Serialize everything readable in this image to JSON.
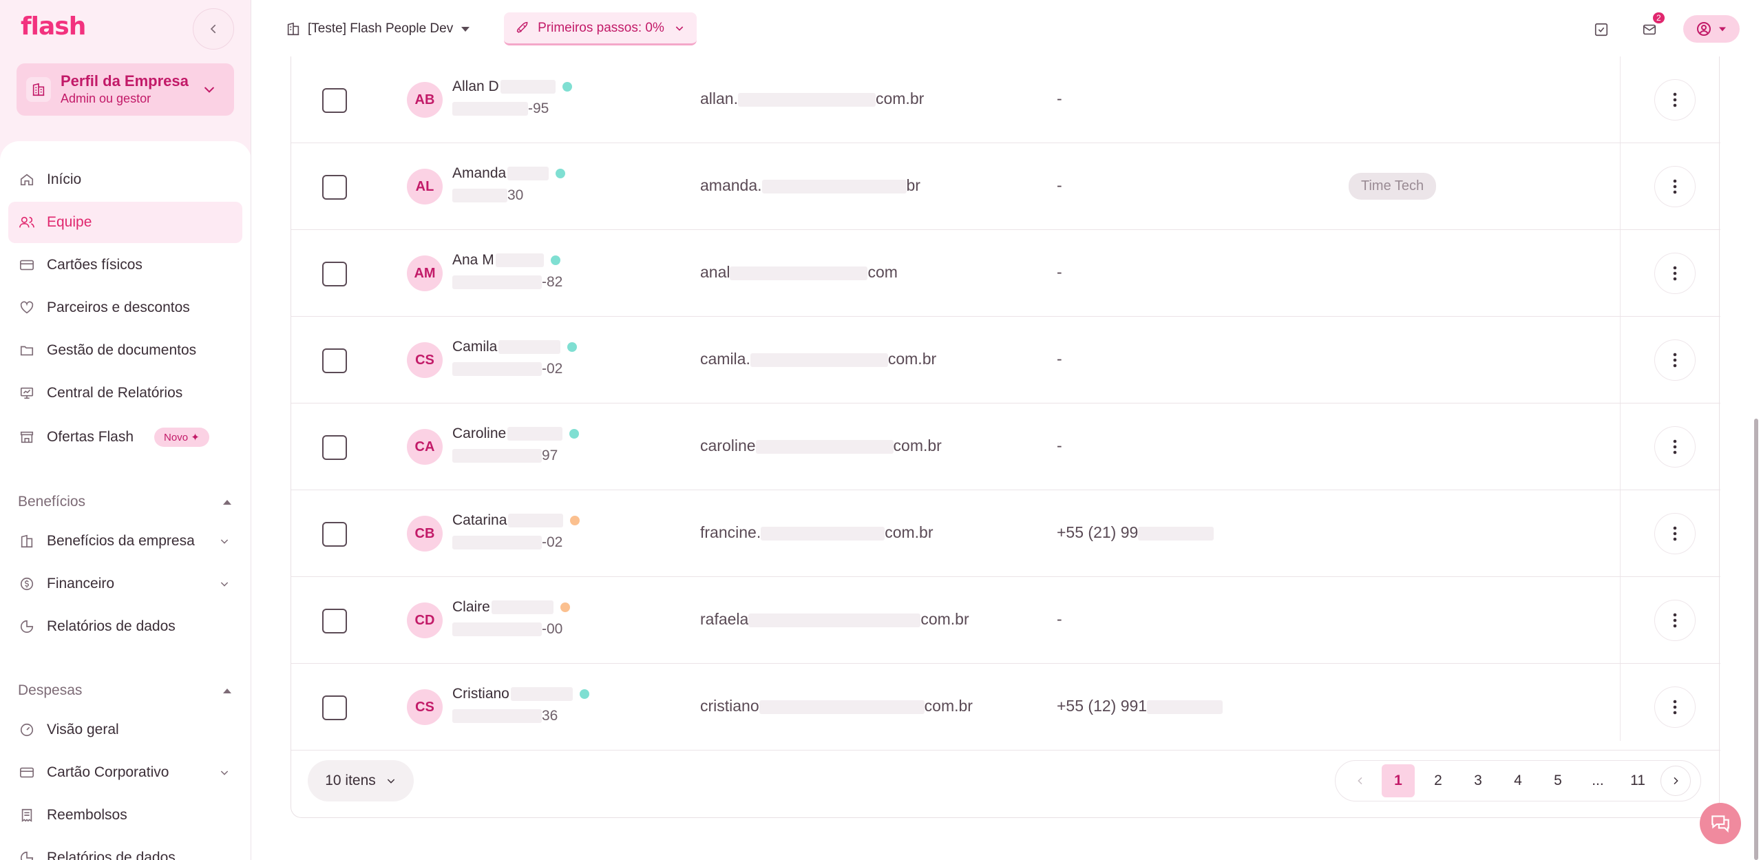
{
  "brand": {
    "logo": "flash"
  },
  "company": {
    "title": "Perfil da Empresa",
    "role": "Admin ou gestor"
  },
  "nav": {
    "inicio": "Início",
    "equipe": "Equipe",
    "cartoes": "Cartões físicos",
    "parceiros": "Parceiros e descontos",
    "documentos": "Gestão de documentos",
    "relatorios": "Central de Relatórios",
    "ofertas": "Ofertas Flash",
    "ofertas_badge": "Novo ✦"
  },
  "beneficios": {
    "header": "Benefícios",
    "empresa": "Benefícios da empresa",
    "financeiro": "Financeiro",
    "relatorios": "Relatórios de dados"
  },
  "despesas": {
    "header": "Despesas",
    "visao": "Visão geral",
    "cartao": "Cartão Corporativo",
    "reembolsos": "Reembolsos",
    "relatorios": "Relatórios de dados"
  },
  "topbar": {
    "workspace": "[Teste] Flash People Dev",
    "onboarding": "Primeiros passos: 0%",
    "notifications_count": "2"
  },
  "rows": [
    {
      "initials": "AB",
      "name": "Allan D",
      "cpf_end": "-95",
      "email_start": "allan.",
      "email_end": "com.br",
      "phone": "-",
      "dept": "",
      "status_color": "#7fdfd2"
    },
    {
      "initials": "AL",
      "name": "Amanda",
      "cpf_end": "30",
      "email_start": "amanda.",
      "email_end": "br",
      "phone": "-",
      "dept": "Time Tech",
      "status_color": "#7fdfd2"
    },
    {
      "initials": "AM",
      "name": "Ana M",
      "cpf_end": "-82",
      "email_start": "anal",
      "email_end": "com",
      "phone": "-",
      "dept": "",
      "status_color": "#7fdfd2"
    },
    {
      "initials": "CS",
      "name": "Camila",
      "cpf_end": "-02",
      "email_start": "camila.",
      "email_end": "com.br",
      "phone": "-",
      "dept": "",
      "status_color": "#7fdfd2"
    },
    {
      "initials": "CA",
      "name": "Caroline",
      "cpf_end": "97",
      "email_start": "caroline",
      "email_end": "com.br",
      "phone": "-",
      "dept": "",
      "status_color": "#7fdfd2"
    },
    {
      "initials": "CB",
      "name": "Catarina",
      "cpf_end": "-02",
      "email_start": "francine.",
      "email_end": "com.br",
      "phone": "+55 (21) 99",
      "dept": "",
      "status_color": "#fbc08f"
    },
    {
      "initials": "CD",
      "name": "Claire",
      "cpf_end": "-00",
      "email_start": "rafaela",
      "email_end": "com.br",
      "phone": "-",
      "dept": "",
      "status_color": "#fbc08f"
    },
    {
      "initials": "CS",
      "name": "Cristiano",
      "cpf_end": "36",
      "email_start": "cristiano",
      "email_end": "com.br",
      "phone": "+55 (12) 991",
      "dept": "",
      "status_color": "#7fdfd2"
    }
  ],
  "pagination": {
    "page_size_label": "10 itens",
    "pages": [
      "1",
      "2",
      "3",
      "4",
      "5",
      "...",
      "11"
    ],
    "current": "1"
  }
}
